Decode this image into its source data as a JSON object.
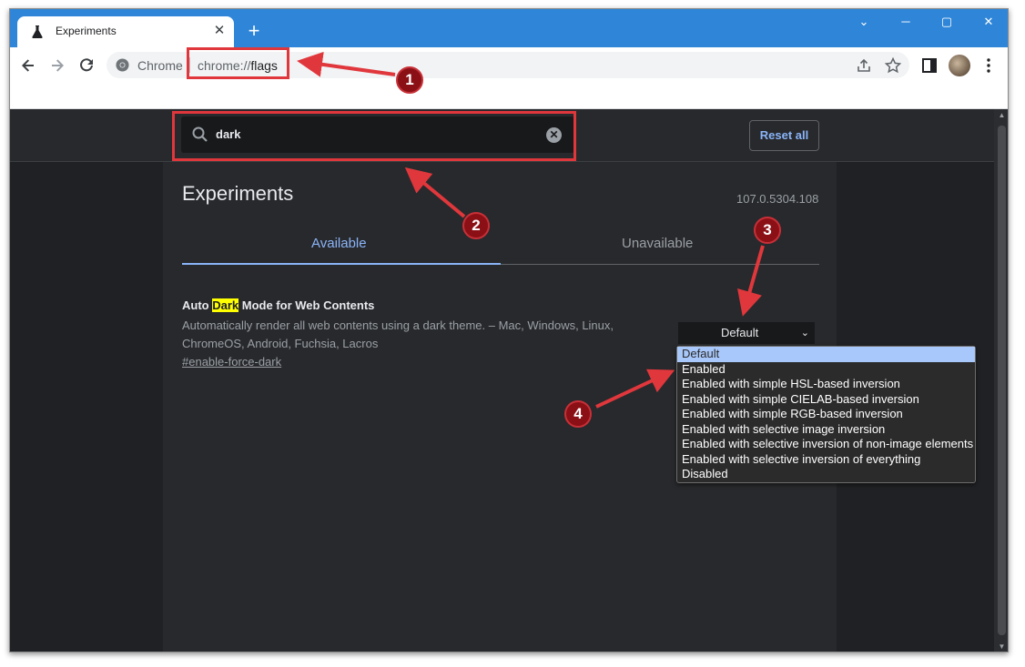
{
  "browser": {
    "tab_title": "Experiments",
    "tab_close": "✕",
    "new_tab": "+",
    "window_controls": {
      "minimize": "─",
      "maximize": "▢",
      "close": "✕",
      "menu": "⌄"
    },
    "omnibox": {
      "site_chip": "Chrome",
      "url_scheme": "chrome://",
      "url_path": "flags"
    }
  },
  "page": {
    "search": {
      "value": "dark",
      "clear_label": "✕"
    },
    "reset_all_label": "Reset all",
    "title": "Experiments",
    "version": "107.0.5304.108",
    "tabs": {
      "available": "Available",
      "unavailable": "Unavailable"
    },
    "flag": {
      "title_before": "Auto ",
      "title_highlight": "Dark",
      "title_after": " Mode for Web Contents",
      "description": "Automatically render all web contents using a dark theme. – Mac, Windows, Linux, ChromeOS, Android, Fuchsia, Lacros",
      "link": "#enable-force-dark",
      "selected_option": "Default"
    },
    "dropdown_options": [
      "Default",
      "Enabled",
      "Enabled with simple HSL-based inversion",
      "Enabled with simple CIELAB-based inversion",
      "Enabled with simple RGB-based inversion",
      "Enabled with selective image inversion",
      "Enabled with selective inversion of non-image elements",
      "Enabled with selective inversion of everything",
      "Disabled"
    ]
  },
  "annotations": {
    "badge1": "1",
    "badge2": "2",
    "badge3": "3",
    "badge4": "4",
    "color": "#e0373c"
  },
  "icons": [
    "flask-icon",
    "back-arrow-icon",
    "forward-arrow-icon",
    "reload-icon",
    "chrome-icon",
    "share-icon",
    "star-icon",
    "sidepanel-icon",
    "avatar",
    "kebab-menu-icon",
    "search-icon",
    "clear-icon",
    "chevron-down-icon"
  ]
}
